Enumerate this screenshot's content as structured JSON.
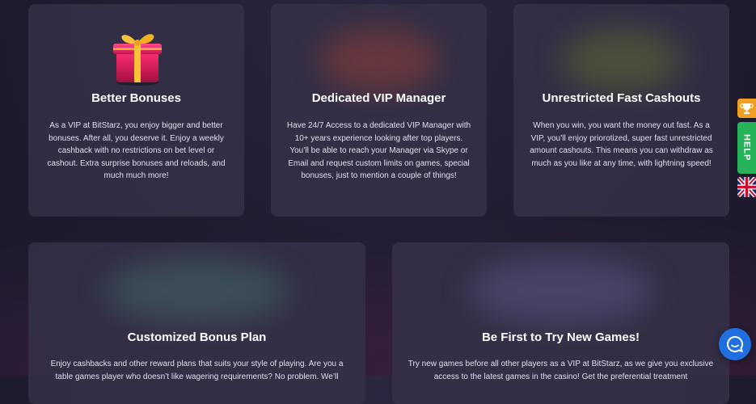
{
  "cards": [
    {
      "title": "Better Bonuses",
      "text": "As a VIP at BitStarz, you enjoy bigger and better bonuses. After all, you deserve it. Enjoy a weekly cashback with no restrictions on bet level or cashout. Extra surprise bonuses and reloads, and much much more!",
      "icon": "gift-icon"
    },
    {
      "title": "Dedicated VIP Manager",
      "text": "Have 24/7 Access to a dedicated VIP Manager with 10+ years experience looking after top players. You’ll be able to reach your Manager via Skype or Email and request custom limits on games, special bonuses, just to mention a couple of things!"
    },
    {
      "title": "Unrestricted Fast Cashouts",
      "text": "When you win, you want the money out fast. As a VIP, you’ll enjoy priorotized, super fast unrestricted amount cashouts. This means you can withdraw as much as you like at any time, with lightning speed!"
    },
    {
      "title": "Customized Bonus Plan",
      "text": "Enjoy cashbacks and other reward plans that suits your style of playing. Are you a table games player who doesn’t like wagering requirements? No problem. We’ll"
    },
    {
      "title": "Be First to Try New Games!",
      "text": "Try new games before all other players as a VIP at BitStarz, as we give you exclusive access to the latest games in the casino! Get the preferential treatment"
    }
  ],
  "side_tabs": {
    "help_label": "HELP",
    "trophy_icon": "trophy-icon",
    "flag_icon": "uk-flag-icon"
  },
  "chat": {
    "icon": "chat-icon",
    "color": "#1f6fe0"
  }
}
